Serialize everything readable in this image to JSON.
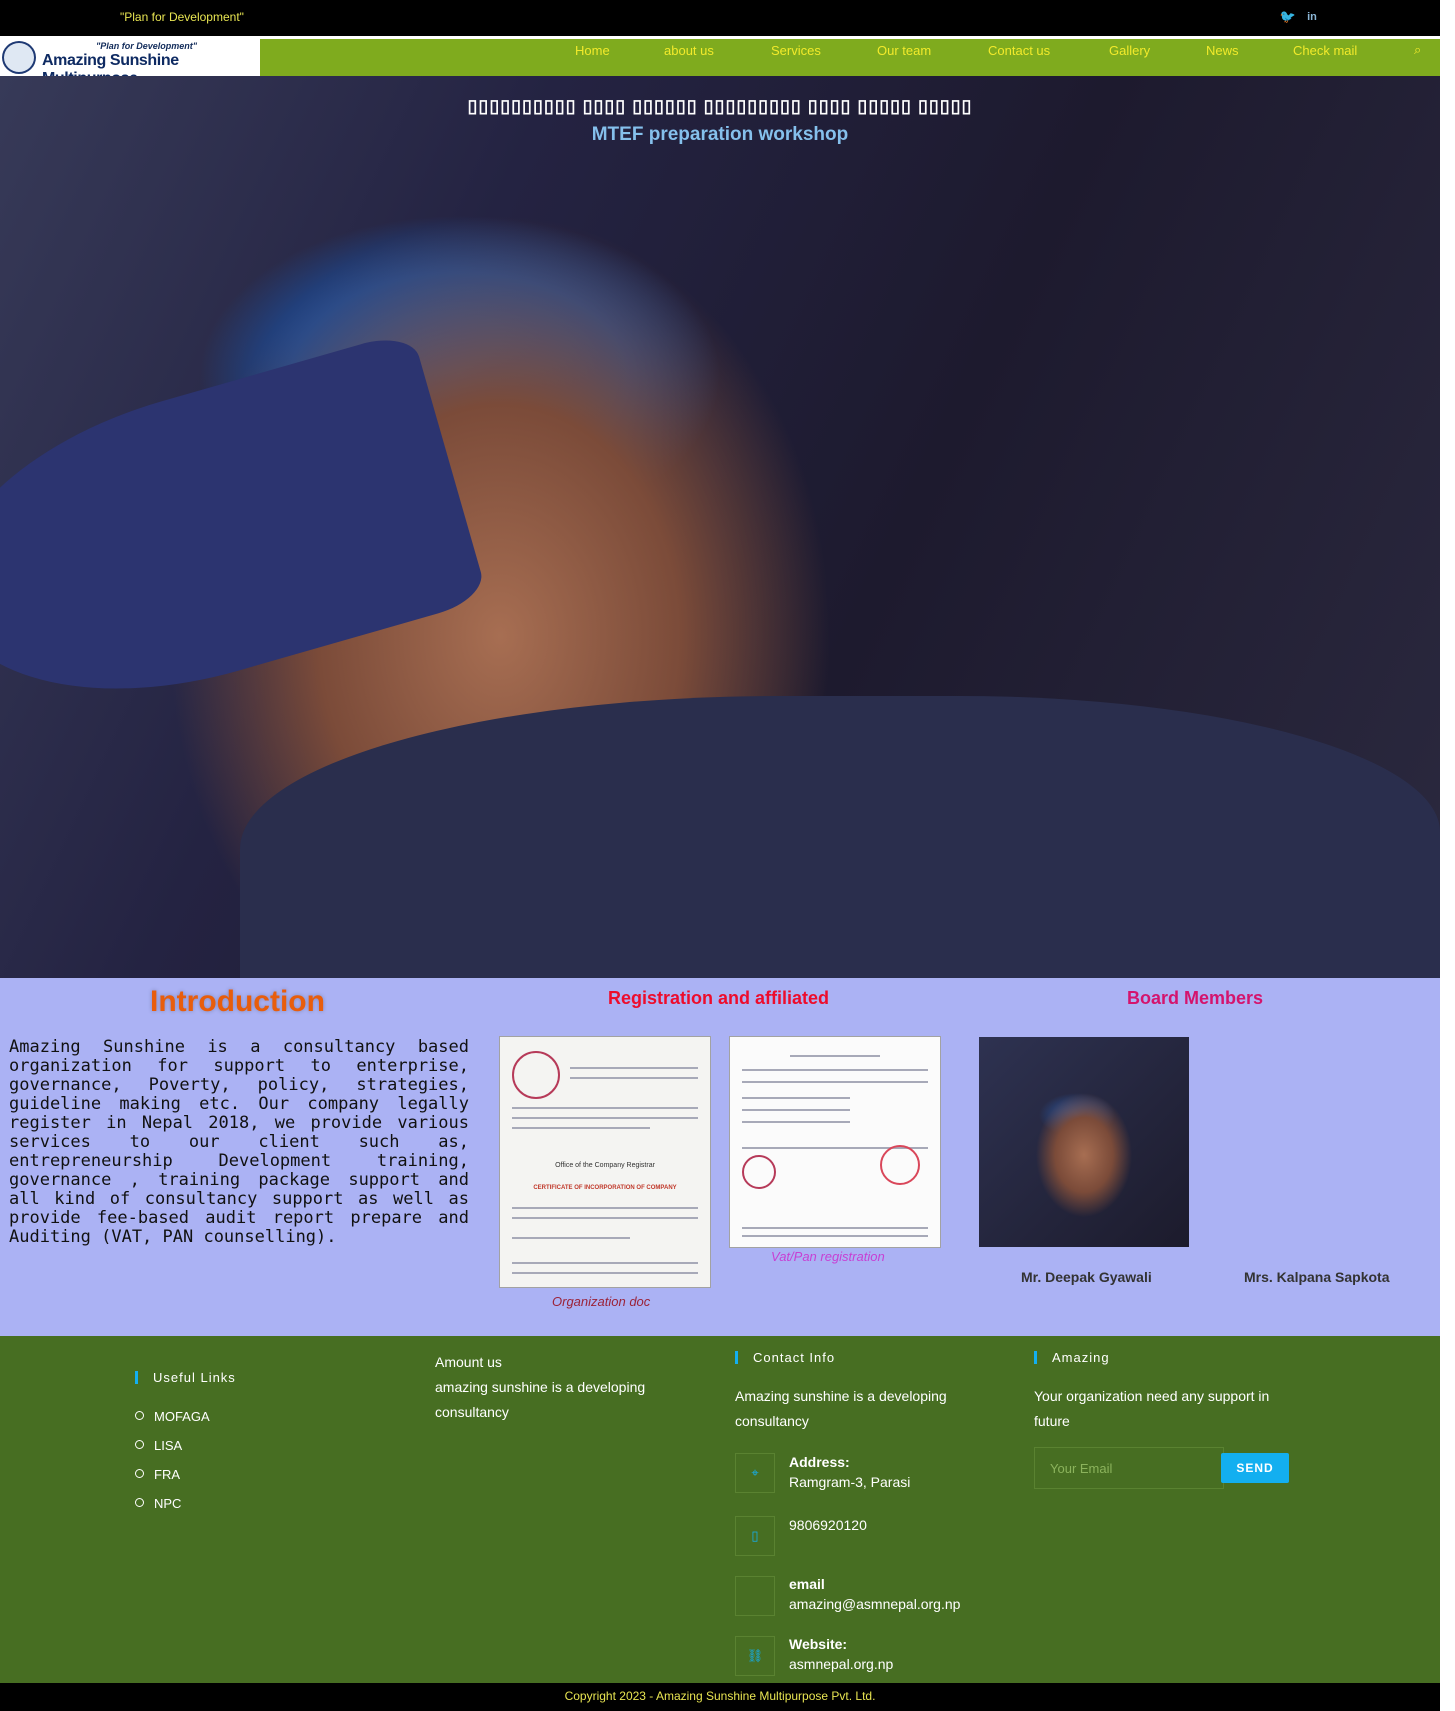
{
  "topbar": {
    "tagline": "\"Plan for Development\"",
    "social": [
      {
        "icon": "twitter-icon",
        "glyph": "🐦"
      },
      {
        "icon": "linkedin-icon",
        "glyph": "in"
      }
    ]
  },
  "logo": {
    "tagline": "\"Plan for Development\"",
    "name": "Amazing Sunshine Multipurpose"
  },
  "nav": {
    "items": [
      "Home",
      "about us",
      "Services",
      "Our team",
      "Contact us",
      "Gallery",
      "News",
      "Check mail"
    ],
    "search_icon": "search-icon"
  },
  "hero": {
    "title": "▯▯▯▯▯▯▯▯▯▯ ▯▯▯▯ ▯▯▯▯▯▯ ▯▯▯▯▯▯▯▯▯ ▯▯▯▯ ▯▯▯▯▯ ▯▯▯▯▯",
    "subtitle": "MTEF preparation workshop"
  },
  "intro": {
    "title": "Introduction",
    "text": "Amazing Sunshine is a consultancy based organization for support to enterprise, governance, Poverty, policy, strategies, guideline making etc. Our company legally register in Nepal 2018, we provide various services to our client such as, entrepreneurship Development training, governance , training package support and all kind of consultancy support as well as provide fee-based audit report prepare and Auditing (VAT, PAN counselling)."
  },
  "registration": {
    "title": "Registration and affiliated",
    "docs": [
      {
        "caption": "Organization doc",
        "heading": "Office of the Company Registrar",
        "subheading": "CERTIFICATE OF INCORPORATION OF COMPANY"
      },
      {
        "caption": "Vat/Pan registration"
      }
    ]
  },
  "board": {
    "title": "Board Members",
    "members": [
      "Mr. Deepak Gyawali",
      "Mrs. Kalpana Sapkota"
    ]
  },
  "footer": {
    "useful_links": {
      "title": "Useful Links",
      "items": [
        "MOFAGA",
        "LISA",
        "FRA",
        "NPC"
      ]
    },
    "about": {
      "title": "Amount us",
      "text": "amazing sunshine is a developing consultancy"
    },
    "contact": {
      "title": "Contact Info",
      "intro": "Amazing sunshine is a developing consultancy",
      "address_label": "Address:",
      "address": "Ramgram-3, Parasi",
      "phone": "9806920120",
      "email_label": "email",
      "email": "amazing@asmnepal.org.np",
      "website_label": "Website:",
      "website": "asmnepal.org.np"
    },
    "newsletter": {
      "title": "Amazing",
      "text": "Your organization need any support in future",
      "placeholder": "Your Email",
      "button": "SEND"
    }
  },
  "copyright": "Copyright 2023 - Amazing Sunshine Multipurpose Pvt. Ltd.",
  "colors": {
    "nav_bg": "#7fab1e",
    "nav_text": "#f2ea2b",
    "info_bg": "#abb2f4",
    "footer_bg": "#476e22",
    "accent": "#13aff0"
  }
}
